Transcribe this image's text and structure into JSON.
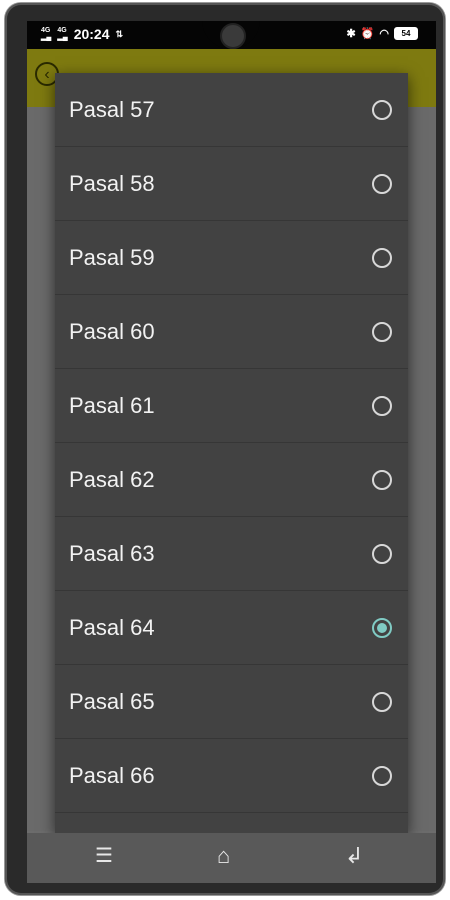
{
  "status_bar": {
    "network_left": [
      "4G",
      "4G"
    ],
    "time": "20:24",
    "battery": "54"
  },
  "app_bar": {
    "back_icon": "back-arrow-icon"
  },
  "dialog": {
    "items": [
      {
        "label": "Pasal 57",
        "selected": false
      },
      {
        "label": "Pasal 58",
        "selected": false
      },
      {
        "label": "Pasal 59",
        "selected": false
      },
      {
        "label": "Pasal 60",
        "selected": false
      },
      {
        "label": "Pasal 61",
        "selected": false
      },
      {
        "label": "Pasal 62",
        "selected": false
      },
      {
        "label": "Pasal 63",
        "selected": false
      },
      {
        "label": "Pasal 64",
        "selected": true
      },
      {
        "label": "Pasal 65",
        "selected": false
      },
      {
        "label": "Pasal 66",
        "selected": false
      }
    ],
    "accent_color": "#80cbc4"
  },
  "nav_bar": {
    "icons": [
      "menu-icon",
      "home-icon",
      "back-icon"
    ]
  }
}
